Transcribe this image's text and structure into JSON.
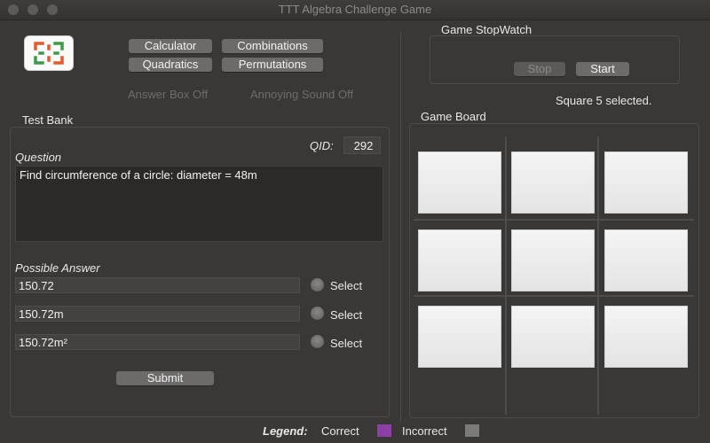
{
  "window": {
    "title": "TTT Algebra Challenge Game"
  },
  "tools": {
    "calculator": "Calculator",
    "combinations": "Combinations",
    "quadratics": "Quadratics",
    "permutations": "Permutations"
  },
  "toggles": {
    "answer_box": "Answer Box Off",
    "annoying_sound": "Annoying Sound Off"
  },
  "test_bank": {
    "title": "Test Bank",
    "question_label": "Question",
    "qid_label": "QID:",
    "qid_value": "292",
    "question_text": "Find circumference of a circle: diameter = 48m",
    "possible_answer_label": "Possible Answer",
    "answers": [
      {
        "value": "150.72",
        "select_label": "Select"
      },
      {
        "value": "150.72m",
        "select_label": "Select"
      },
      {
        "value": "150.72m²",
        "select_label": "Select"
      }
    ],
    "submit_label": "Submit"
  },
  "stopwatch": {
    "title": "Game StopWatch",
    "stop_label": "Stop",
    "start_label": "Start"
  },
  "status": {
    "selection": "Square 5 selected."
  },
  "game_board": {
    "title": "Game Board",
    "cells": [
      "",
      "",
      "",
      "",
      "",
      "",
      "",
      "",
      ""
    ]
  },
  "legend": {
    "label": "Legend:",
    "correct_label": "Correct",
    "correct_color": "#8e3fa3",
    "incorrect_label": "Incorrect",
    "incorrect_color": "#7a7a7a"
  }
}
